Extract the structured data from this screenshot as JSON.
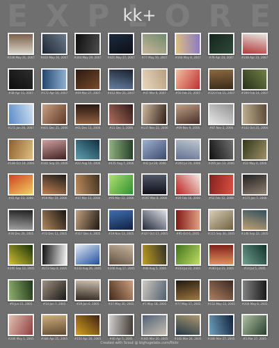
{
  "background_word": [
    "E",
    "X",
    "P",
    "L",
    "O",
    "R",
    "E"
  ],
  "title": "kk+",
  "footer": "Created with Scout @ bighugelabs.com/flickr",
  "rows": [
    [
      {
        "meta": "#238 May 31, 2007",
        "c1": "#d9d4c9",
        "c2": "#7a5f4a"
      },
      {
        "meta": "#433 May 30, 2007",
        "c1": "#1e2533",
        "c2": "#6c7a8a"
      },
      {
        "meta": "#344 May 29, 2007",
        "c1": "#0d0d0d",
        "c2": "#4d4d4d"
      },
      {
        "meta": "#421 May 27, 2007",
        "c1": "#1d2a3d",
        "c2": "#0b0f16"
      },
      {
        "meta": "#77 May 10, 2007",
        "c1": "#6f8a6e",
        "c2": "#c8b69a"
      },
      {
        "meta": "#164 May 8, 2007",
        "c1": "#8a78c4",
        "c2": "#e0c080"
      },
      {
        "meta": "#76 Apr 24, 2007",
        "c1": "#2d4a3a",
        "c2": "#15251c"
      },
      {
        "meta": "#238 Apr 23, 2007",
        "c1": "#b03a3a",
        "c2": "#e6e2dc"
      }
    ],
    [
      {
        "meta": "#38 Apr 11, 2007",
        "c1": "#0c0c0c",
        "c2": "#2e2e2e"
      },
      {
        "meta": "#172 Apr 10, 2007",
        "c1": "#23466d",
        "c2": "#8fb0d0"
      },
      {
        "meta": "#49 Mar 27, 2007",
        "c1": "#2b1a12",
        "c2": "#7a4a2a"
      },
      {
        "meta": "#412 Mar 21, 2007",
        "c1": "#1a2030",
        "c2": "#6680a0"
      },
      {
        "meta": "#47 Mar 9, 2007",
        "c1": "#b8a080",
        "c2": "#e8d8c0"
      },
      {
        "meta": "#50 Feb 21, 2007",
        "c1": "#c03030",
        "c2": "#f0c0a0"
      },
      {
        "meta": "#220 Feb 15, 2007",
        "c1": "#3a2a1a",
        "c2": "#8a6a40"
      },
      {
        "meta": "#399 Feb 14, 2007",
        "c1": "#283018",
        "c2": "#708048"
      }
    ],
    [
      {
        "meta": "#171 Jan 26, 2007",
        "c1": "#5a8ac8",
        "c2": "#cfe0f0"
      },
      {
        "meta": "#401 Dec 25, 2006",
        "c1": "#c8a080",
        "c2": "#603828"
      },
      {
        "meta": "#61 Dec 11, 2006",
        "c1": "#281810",
        "c2": "#906040"
      },
      {
        "meta": "#21 Dec 1, 2006",
        "c1": "#301818",
        "c2": "#b07060"
      },
      {
        "meta": "#137 Nov 22, 2006",
        "c1": "#302018",
        "c2": "#d0b8a0"
      },
      {
        "meta": "#69 Nov 9, 2006",
        "c1": "#483028",
        "c2": "#c0a088"
      },
      {
        "meta": "#87 Nov 2, 2006",
        "c1": "#e8e8e8",
        "c2": "#909090"
      },
      {
        "meta": "#102 Oct 25, 2006",
        "c1": "#c0b090",
        "c2": "#5a4a38"
      }
    ],
    [
      {
        "meta": "#148 Oct 19, 2006",
        "c1": "#8a6030",
        "c2": "#e0c080"
      },
      {
        "meta": "#381 Sep 19, 2006",
        "c1": "#d0a0a0",
        "c2": "#402020"
      },
      {
        "meta": "#22 Aug 16, 2006",
        "c1": "#103040",
        "c2": "#60a0b0"
      },
      {
        "meta": "#435 Aug 7, 2006",
        "c1": "#284028",
        "c2": "#90b080"
      },
      {
        "meta": "#42 Jul 28, 2006",
        "c1": "#3a4a6a",
        "c2": "#a0b0d0"
      },
      {
        "meta": "#200 Jul 24, 2006",
        "c1": "#607090",
        "c2": "#c0c8d0"
      },
      {
        "meta": "#395 Jun 13, 2006",
        "c1": "#101010",
        "c2": "#707070"
      },
      {
        "meta": "#22 May 4, 2006",
        "c1": "#303818",
        "c2": "#a09068"
      }
    ],
    [
      {
        "meta": "#41 Apr 23, 2006",
        "c1": "#d04020",
        "c2": "#f0d060"
      },
      {
        "meta": "#19 Mar 19, 2006",
        "c1": "#1a1a1a",
        "c2": "#c08050"
      },
      {
        "meta": "#37 Mar 13, 2006",
        "c1": "#403020",
        "c2": "#c09060"
      },
      {
        "meta": "#95 Mar 12, 2006",
        "c1": "#309030",
        "c2": "#b0e070"
      },
      {
        "meta": "#297 Mar 8, 2006",
        "c1": "#101018",
        "c2": "#50586a"
      },
      {
        "meta": "#29 Feb 16, 2006",
        "c1": "#c02020",
        "c2": "#f0e8e0"
      },
      {
        "meta": "#52 Feb 12, 2006",
        "c1": "#802020",
        "c2": "#e05040"
      },
      {
        "meta": "#175 Jan 7, 2006",
        "c1": "#202020",
        "c2": "#908070"
      }
    ],
    [
      {
        "meta": "#36 Dec 20, 2005",
        "c1": "#202020",
        "c2": "#a0a0a0"
      },
      {
        "meta": "#72 Dec 11, 2005",
        "c1": "#1a1410",
        "c2": "#b08860"
      },
      {
        "meta": "#317 Dec 4, 2005",
        "c1": "#201810",
        "c2": "#c0a080"
      },
      {
        "meta": "#19 Nov 13, 2005",
        "c1": "#102040",
        "c2": "#4070b0"
      },
      {
        "meta": "#327 Oct 17, 2005",
        "c1": "#202838",
        "c2": "#e0e0e8"
      },
      {
        "meta": "#95 Oct 6, 2005",
        "c1": "#801818",
        "c2": "#e0a080"
      },
      {
        "meta": "#115 Sep 30, 2005",
        "c1": "#d8d0b8",
        "c2": "#706040"
      },
      {
        "meta": "#146 Sep 22, 2005",
        "c1": "#305060",
        "c2": "#c0a070"
      }
    ],
    [
      {
        "meta": "#295 Sep 13, 2005",
        "c1": "#183008",
        "c2": "#d0c030"
      },
      {
        "meta": "#273 Sep 4, 2005",
        "c1": "#f0f0f0",
        "c2": "#101010"
      },
      {
        "meta": "#233 Aug 26, 2005",
        "c1": "#2050a0",
        "c2": "#e0e8f0"
      },
      {
        "meta": "#206 Aug 17, 2005",
        "c1": "#605040",
        "c2": "#c8b8a0"
      },
      {
        "meta": "#40 Aug 5, 2005",
        "c1": "#c0a020",
        "c2": "#303028"
      },
      {
        "meta": "#233 Jul 22, 2005",
        "c1": "#407020",
        "c2": "#c0e060"
      },
      {
        "meta": "#283 Jul 21, 2005",
        "c1": "#802018",
        "c2": "#e09060"
      },
      {
        "meta": "#14 Jul 5, 2005",
        "c1": "#103028",
        "c2": "#70a090"
      }
    ],
    [
      {
        "meta": "#9 Jun 21, 2005",
        "c1": "#203818",
        "c2": "#90b070"
      },
      {
        "meta": "#14 Jun 7, 2005",
        "c1": "#181818",
        "c2": "#a09080"
      },
      {
        "meta": "#29 Jun 6, 2005",
        "c1": "#302820",
        "c2": "#d0c0b0"
      },
      {
        "meta": "#37 May 30, 2005",
        "c1": "#402818",
        "c2": "#d0a080"
      },
      {
        "meta": "#7 May 18, 2005",
        "c1": "#d0c8c0",
        "c2": "#506070"
      },
      {
        "meta": "#77 May 17, 2005",
        "c1": "#201810",
        "c2": "#a07840"
      },
      {
        "meta": "#152 May 13, 2005",
        "c1": "#382820",
        "c2": "#b08060"
      },
      {
        "meta": "#204 May 8, 2005",
        "c1": "#1a1a1a",
        "c2": "#808080"
      }
    ],
    [
      {
        "meta": "#286 May 1, 2005",
        "c1": "#904040",
        "c2": "#e0c0b0"
      },
      {
        "meta": "#184 Apr 25, 2005",
        "c1": "#604830",
        "c2": "#d0b080"
      },
      {
        "meta": "#150 Apr 20, 2005",
        "c1": "#d0a020",
        "c2": "#402010"
      },
      {
        "meta": "#40 Apr 5, 2005",
        "c1": "#d0d0d0",
        "c2": "#403830"
      },
      {
        "meta": "#365 Mar 20, 2005",
        "c1": "#506078",
        "c2": "#c8c0b0"
      },
      {
        "meta": "#102 Mar 24, 2005",
        "c1": "#b09870",
        "c2": "#203848"
      },
      {
        "meta": "#380 Mar 27, 2005",
        "c1": "#102038",
        "c2": "#70a0c0"
      },
      {
        "meta": "#5 Mar 27, 2005",
        "c1": "#284030",
        "c2": "#b0c0a0"
      }
    ]
  ]
}
